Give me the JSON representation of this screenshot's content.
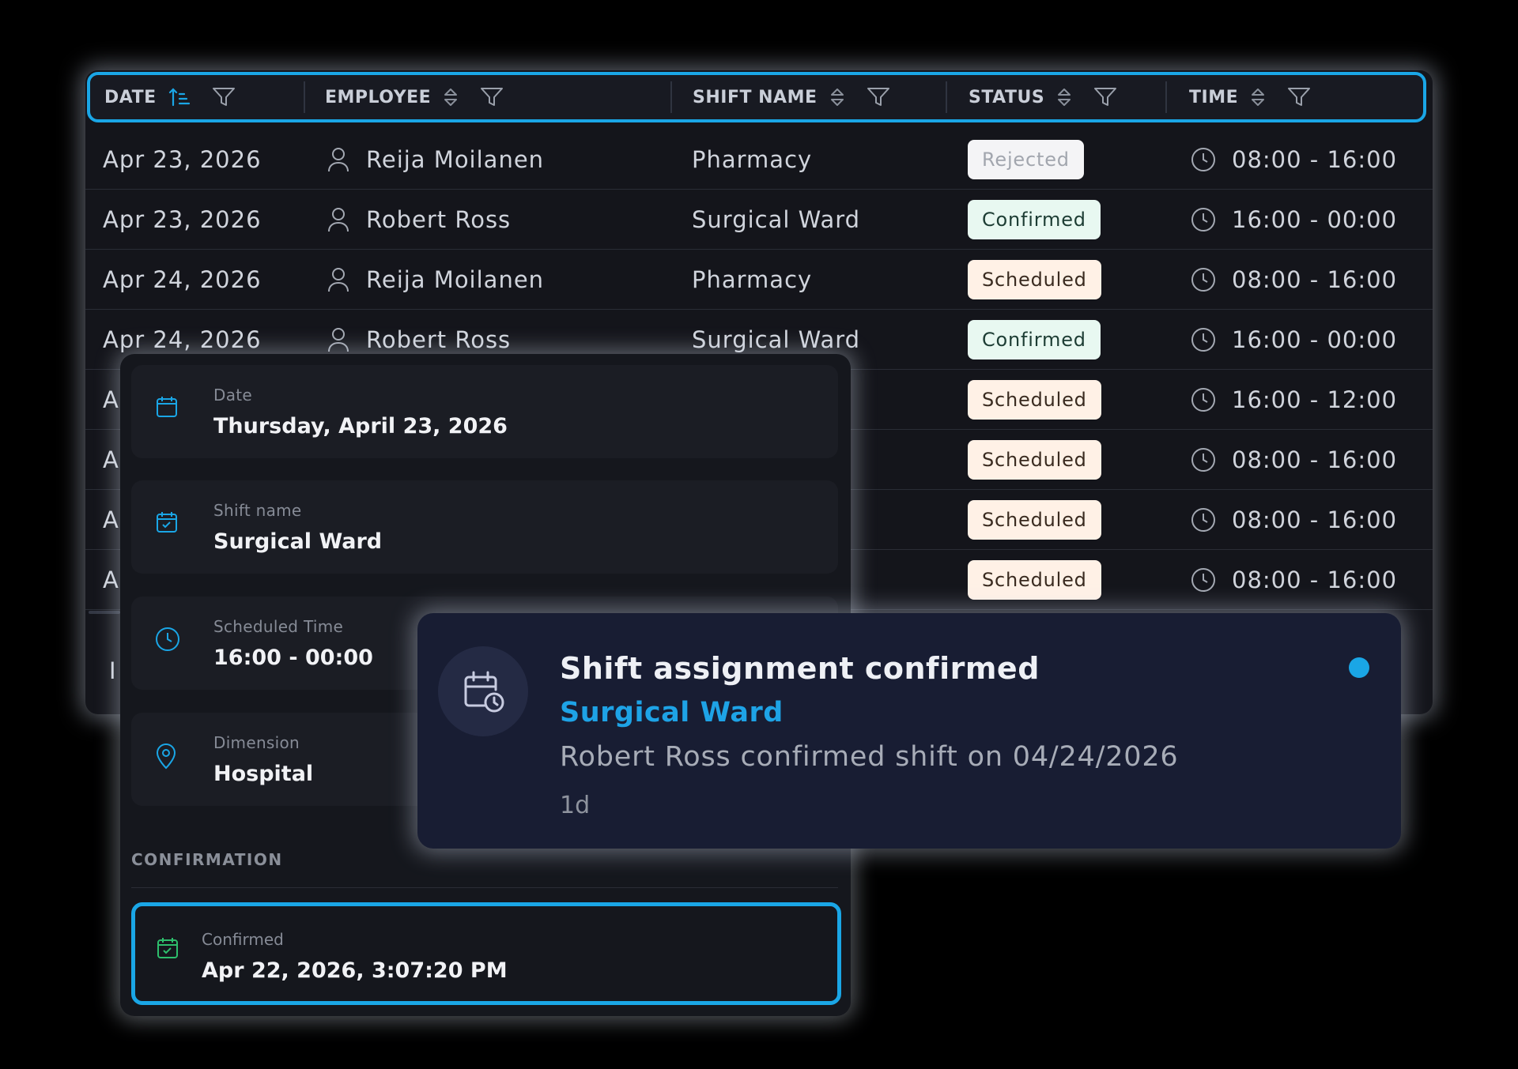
{
  "table": {
    "columns": [
      {
        "label": "DATE",
        "sort_icon": "sort-ascending-icon"
      },
      {
        "label": "EMPLOYEE",
        "sort_icon": "sort-icon"
      },
      {
        "label": "SHIFT NAME",
        "sort_icon": "sort-icon"
      },
      {
        "label": "STATUS",
        "sort_icon": "sort-icon"
      },
      {
        "label": "TIME",
        "sort_icon": "sort-icon"
      }
    ],
    "rows": [
      {
        "date": "Apr 23, 2026",
        "employee": "Reija Moilanen",
        "shift": "Pharmacy",
        "status": "Rejected",
        "time": "08:00 - 16:00"
      },
      {
        "date": "Apr 23, 2026",
        "employee": "Robert Ross",
        "shift": "Surgical Ward",
        "status": "Confirmed",
        "time": "16:00 - 00:00"
      },
      {
        "date": "Apr 24, 2026",
        "employee": "Reija Moilanen",
        "shift": "Pharmacy",
        "status": "Scheduled",
        "time": "08:00 - 16:00"
      },
      {
        "date": "Apr 24, 2026",
        "employee": "Robert Ross",
        "shift": "Surgical Ward",
        "status": "Confirmed",
        "time": "16:00 - 00:00"
      },
      {
        "date": "A",
        "employee": "",
        "shift": "",
        "status": "Scheduled",
        "time": "16:00 - 12:00"
      },
      {
        "date": "A",
        "employee": "",
        "shift": "",
        "status": "Scheduled",
        "time": "08:00 - 16:00"
      },
      {
        "date": "A",
        "employee": "",
        "shift": "",
        "status": "Scheduled",
        "time": "08:00 - 16:00"
      },
      {
        "date": "A",
        "employee": "",
        "shift": "",
        "status": "Scheduled",
        "time": "08:00 - 16:00"
      }
    ],
    "footer_fragment": "I"
  },
  "details": {
    "date_label": "Date",
    "date_value": "Thursday, April 23, 2026",
    "shift_label": "Shift name",
    "shift_value": "Surgical Ward",
    "time_label": "Scheduled Time",
    "time_value": "16:00 - 00:00",
    "dimension_label": "Dimension",
    "dimension_value": "Hospital",
    "section_title": "CONFIRMATION",
    "confirmed_label": "Confirmed",
    "confirmed_value": "Apr 22, 2026, 3:07:20 PM"
  },
  "notification": {
    "title": "Shift assignment confirmed",
    "subtitle": "Surgical Ward",
    "body": "Robert Ross confirmed shift on 04/24/2026",
    "age": "1d"
  },
  "colors": {
    "accent": "#1aa6e6",
    "rejected_bg": "#f4f4f6",
    "confirmed_bg": "#e8f8f1",
    "scheduled_bg": "#fff1e6"
  }
}
